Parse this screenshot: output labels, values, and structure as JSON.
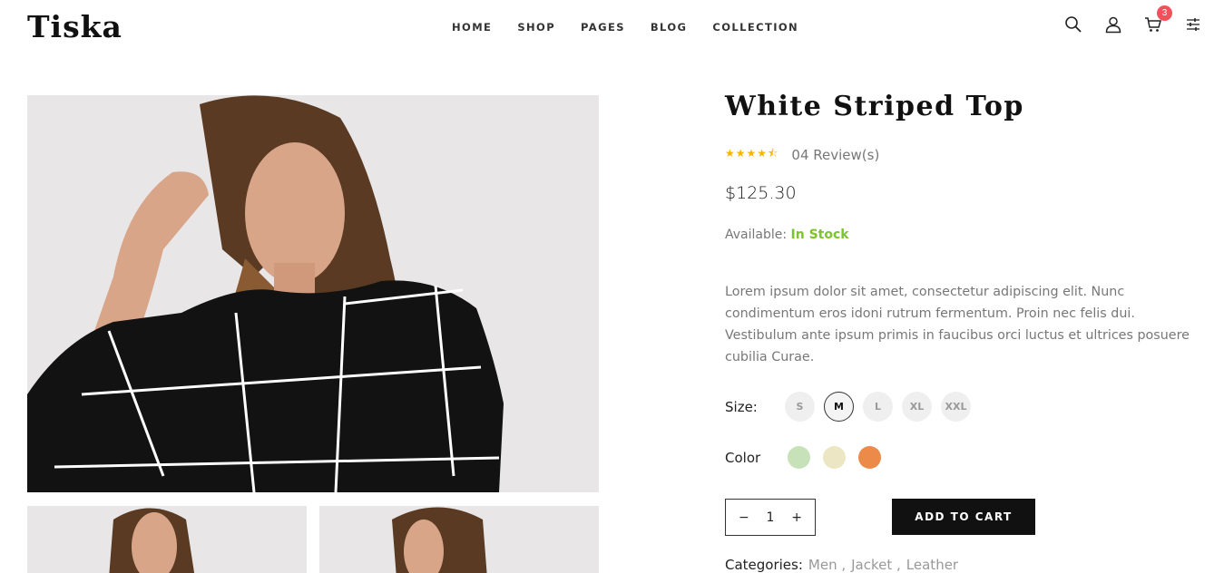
{
  "brand": {
    "logo": "Tiska"
  },
  "nav": {
    "items": [
      "HOME",
      "SHOP",
      "PAGES",
      "BLOG",
      "COLLECTION"
    ]
  },
  "header_icons": {
    "search": "search-icon",
    "user": "user-icon",
    "cart": "cart-icon",
    "settings": "sliders-icon",
    "cart_count": "3"
  },
  "product": {
    "title": "White Striped Top",
    "stars": "★★★★⯪",
    "rating_value": 4.5,
    "reviews": "04 Review(s)",
    "price": "$125.30",
    "available_label": "Available:",
    "stock": "In Stock",
    "description": "Lorem ipsum dolor sit amet, consectetur adipiscing elit. Nunc condimentum eros idoni rutrum fermentum. Proin nec felis dui. Vestibulum ante ipsum primis in faucibus orci luctus et ultrices posuere cubilia Curae.",
    "size_label": "Size:",
    "sizes": [
      "S",
      "M",
      "L",
      "XL",
      "XXL"
    ],
    "selected_size": "M",
    "color_label": "Color",
    "colors": [
      "#c7e2b8",
      "#ece6c5",
      "#ec8a4a"
    ],
    "quantity": {
      "minus": "−",
      "value": "1",
      "plus": "+"
    },
    "add_to_cart": "ADD TO CART",
    "categories_label": "Categories:",
    "categories": [
      "Men ,",
      "Jacket ,",
      "Leather"
    ]
  },
  "colors": {
    "accent_green": "#7bc42a",
    "star": "#f7b500",
    "badge": "#f0515b",
    "button": "#111111"
  }
}
